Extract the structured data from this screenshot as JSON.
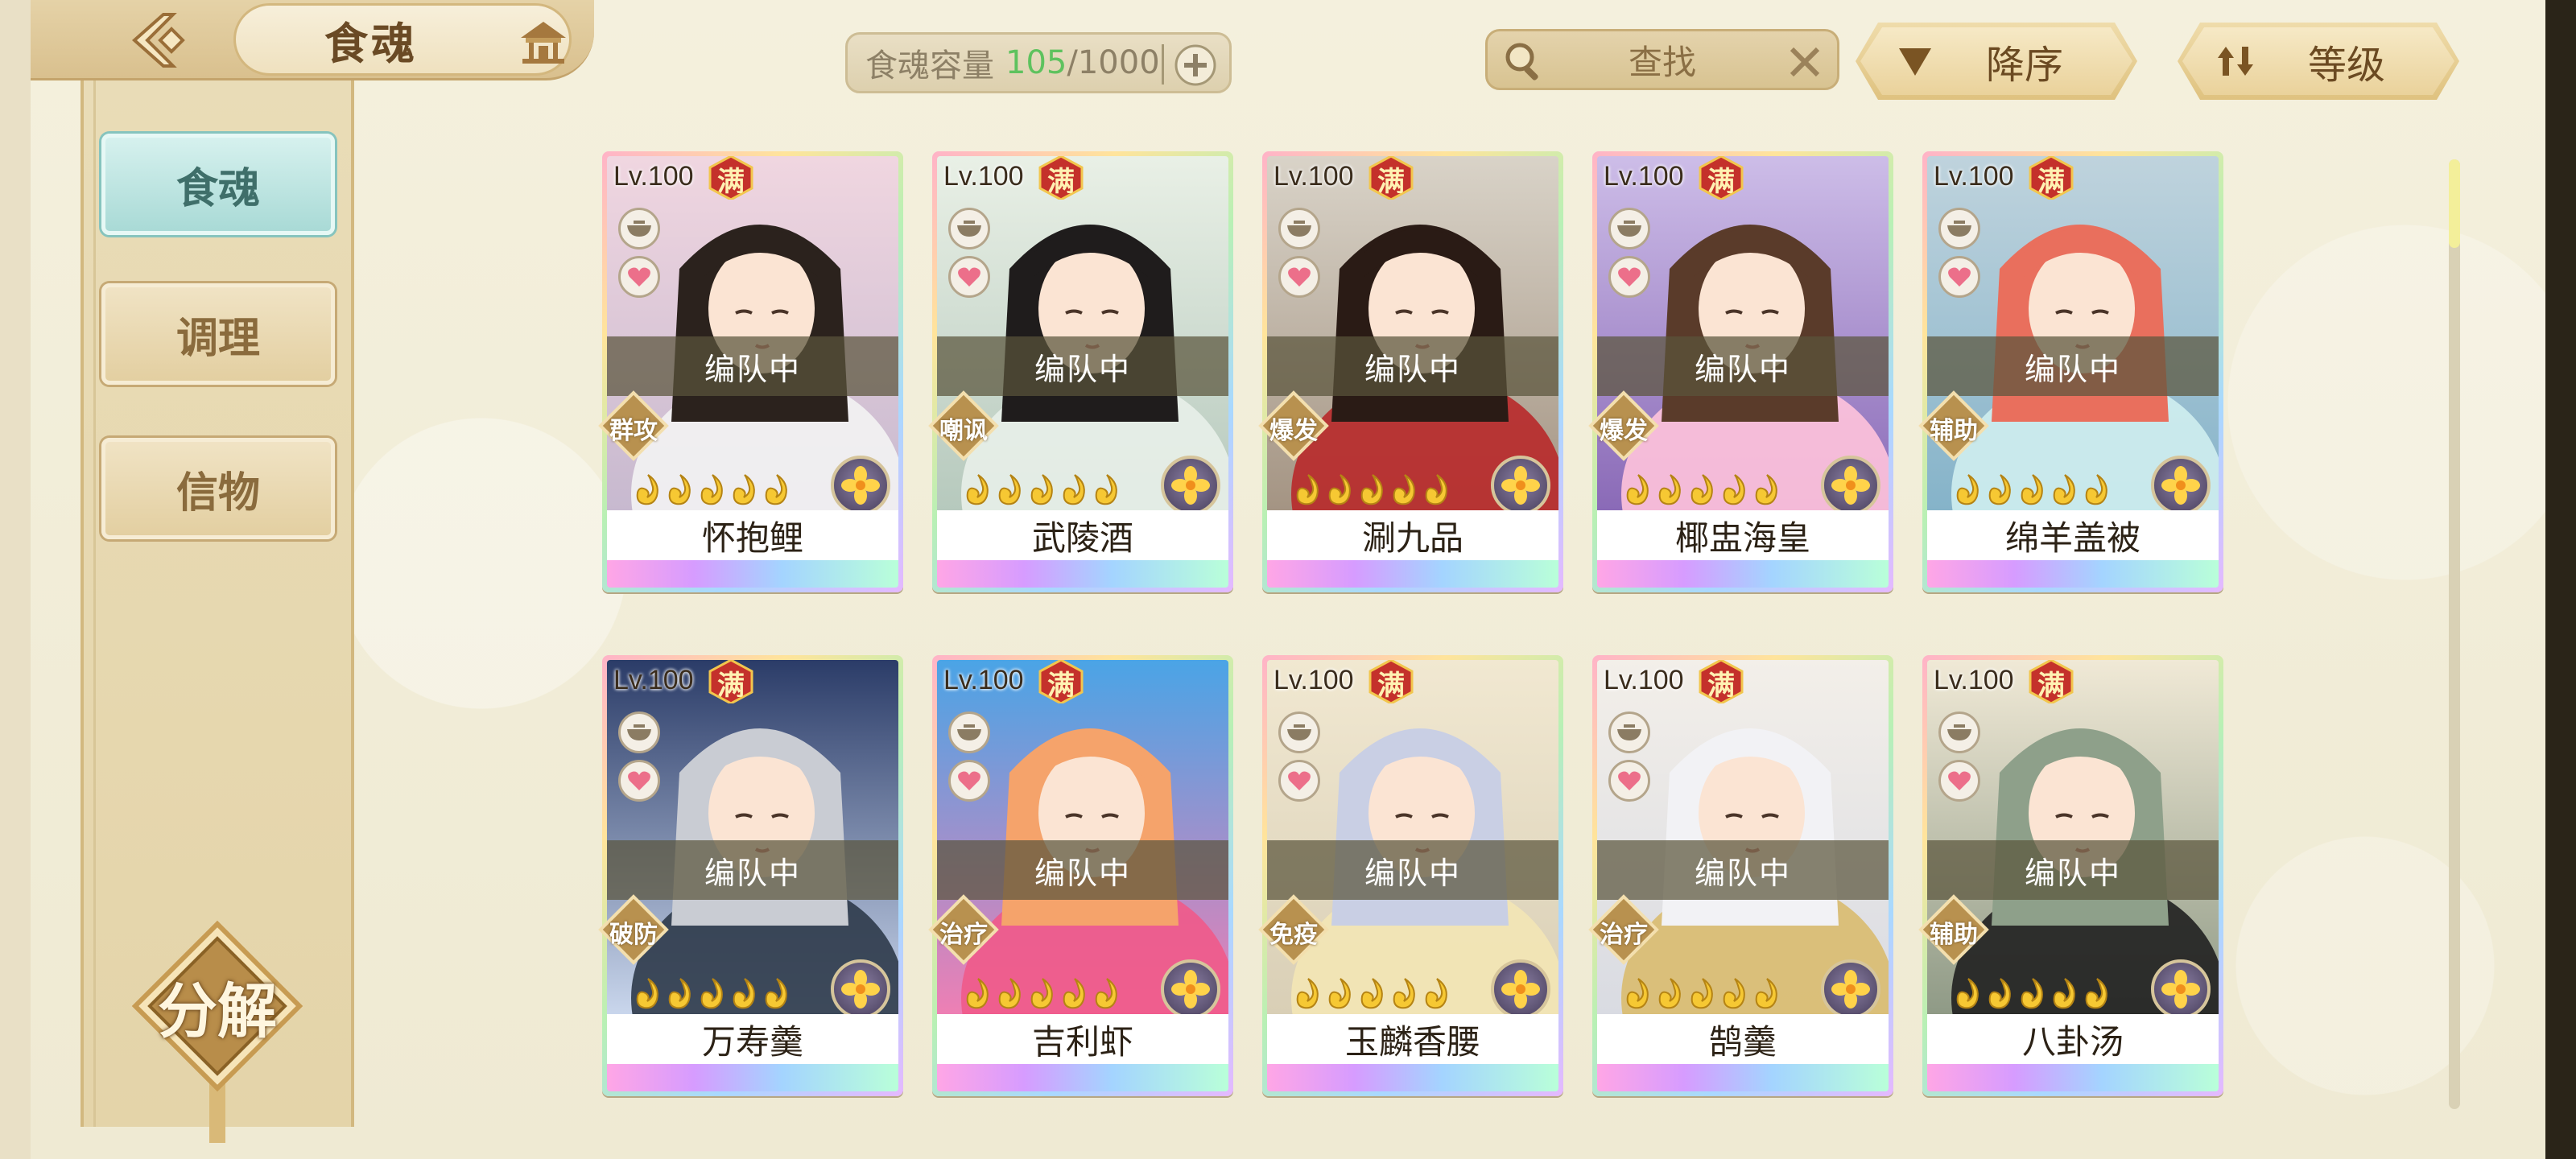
{
  "header": {
    "title": "食魂",
    "capacity_label": "食魂容量",
    "capacity_current": "105",
    "capacity_sep": "/",
    "capacity_max": "1000",
    "search_label": "查找",
    "sort_order_label": "降序",
    "sort_key_label": "等级"
  },
  "sidebar": {
    "items": [
      {
        "label": "食魂",
        "active": true
      },
      {
        "label": "调理",
        "active": false
      },
      {
        "label": "信物",
        "active": false
      }
    ],
    "decompose_label": "分解"
  },
  "cards": [
    {
      "level": "Lv.100",
      "max": "满",
      "status": "编队中",
      "role": "群攻",
      "name": "怀抱鲤",
      "stars": 5,
      "bg": [
        "#f0d6e0",
        "#c7b9cf"
      ],
      "hair": "#2b221d",
      "hair2": "#f3f3f3"
    },
    {
      "level": "Lv.100",
      "max": "满",
      "status": "编队中",
      "role": "嘲讽",
      "name": "武陵酒",
      "stars": 5,
      "bg": [
        "#e9f0e6",
        "#b6c9bd"
      ],
      "hair": "#1f1c1c",
      "hair2": "#e8efe9"
    },
    {
      "level": "Lv.100",
      "max": "满",
      "status": "编队中",
      "role": "爆发",
      "name": "涮九品",
      "stars": 5,
      "bg": [
        "#d9d3c8",
        "#a49483"
      ],
      "hair": "#2a1b15",
      "hair2": "#b8292a"
    },
    {
      "level": "Lv.100",
      "max": "满",
      "status": "编队中",
      "role": "爆发",
      "name": "椰盅海皇",
      "stars": 5,
      "bg": [
        "#cdbde8",
        "#8a6ab7"
      ],
      "hair": "#5a3b2a",
      "hair2": "#ffc3dc"
    },
    {
      "level": "Lv.100",
      "max": "满",
      "status": "编队中",
      "role": "辅助",
      "name": "绵羊盖被",
      "stars": 5,
      "bg": [
        "#bfd3dd",
        "#85b3c9"
      ],
      "hair": "#e96f5d",
      "hair2": "#cfeef0"
    },
    {
      "level": "Lv.100",
      "max": "满",
      "status": "编队中",
      "role": "破防",
      "name": "万寿羹",
      "stars": 5,
      "bg": [
        "#2b3c68",
        "#c9d6ec"
      ],
      "hair": "#c9ccd3",
      "hair2": "#2e3a4a"
    },
    {
      "level": "Lv.100",
      "max": "满",
      "status": "编队中",
      "role": "治疗",
      "name": "吉利虾",
      "stars": 5,
      "bg": [
        "#4aa4e6",
        "#ee7fb4"
      ],
      "hair": "#f5a36b",
      "hair2": "#f05a8a"
    },
    {
      "level": "Lv.100",
      "max": "满",
      "status": "编队中",
      "role": "免疫",
      "name": "玉麟香腰",
      "stars": 5,
      "bg": [
        "#f1e8d1",
        "#d9cfb6"
      ],
      "hair": "#c9cfe4",
      "hair2": "#f3e6b5"
    },
    {
      "level": "Lv.100",
      "max": "满",
      "status": "编队中",
      "role": "治疗",
      "name": "鹄羹",
      "stars": 5,
      "bg": [
        "#f3efe9",
        "#d9dbe2"
      ],
      "hair": "#f2f2f5",
      "hair2": "#d9bb6e"
    },
    {
      "level": "Lv.100",
      "max": "满",
      "status": "编队中",
      "role": "辅助",
      "name": "八卦汤",
      "stars": 5,
      "bg": [
        "#f0e9d6",
        "#8f9a86"
      ],
      "hair": "#8ea08a",
      "hair2": "#202020"
    }
  ],
  "colors": {
    "accent_green": "#5ec25e",
    "active_tab": "#a9dad6",
    "gold": "#d7b46a"
  },
  "icons": {
    "back": "back-arrow-icon",
    "home": "pavilion-icon",
    "add": "plus-icon",
    "search": "magnifier-icon",
    "clear": "close-icon",
    "sort_order": "triangle-down-icon",
    "sort_key": "sort-arrows-icon"
  }
}
